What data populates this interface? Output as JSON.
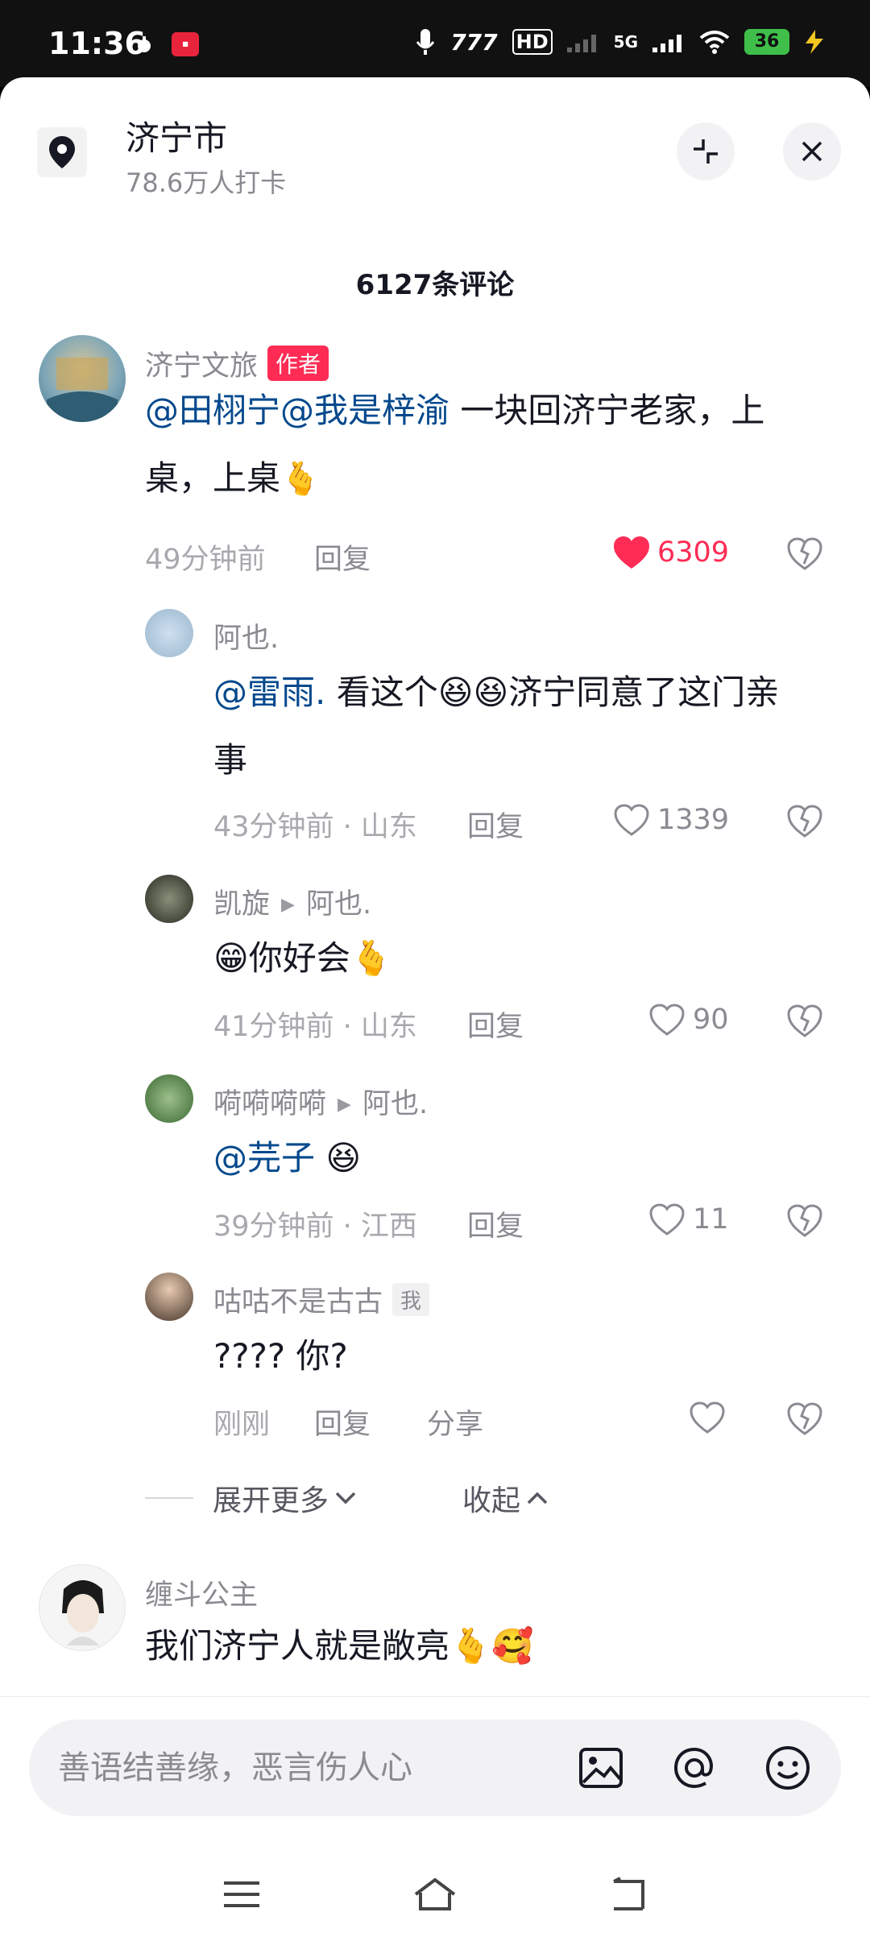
{
  "status": {
    "time": "11:36",
    "network": "5G",
    "battery": "36"
  },
  "header": {
    "location_name": "济宁市",
    "checkins": "78.6万人打卡"
  },
  "comments_title": "6127条评论",
  "comments": [
    {
      "user": "济宁文旅",
      "tag": "作者",
      "mention": "@田栩宁@我是梓渝",
      "text_line1": " 一块回济宁老家，上",
      "text_line2": "桌，上桌",
      "time": "49分钟前",
      "reply": "回复",
      "likes": "6309"
    },
    {
      "user": "阿也.",
      "mention": "@雷雨.",
      "text_line1": " 看这个😆😆济宁同意了这门亲",
      "text_line2": "事",
      "time": "43分钟前 · 山东",
      "reply": "回复",
      "likes": "1339"
    },
    {
      "user": "凯旋",
      "reply_to": "阿也.",
      "text": "😁你好会🫰",
      "time": "41分钟前 · 山东",
      "reply": "回复",
      "likes": "90"
    },
    {
      "user": "嗬嗬嗬嗬",
      "reply_to": "阿也.",
      "mention": "@芫子",
      "text": " 😆",
      "time": "39分钟前 · 江西",
      "reply": "回复",
      "likes": "11"
    },
    {
      "user": "咕咕不是古古",
      "tag": "我",
      "text": "????  你?",
      "time": "刚刚",
      "reply": "回复",
      "share": "分享"
    },
    {
      "user": "缠斗公主",
      "text": "我们济宁人就是敞亮🫰🥰"
    }
  ],
  "expand": {
    "more": "展开更多",
    "collapse": "收起"
  },
  "input": {
    "placeholder": "善语结善缘，恶言伤人心"
  },
  "icons": {
    "heart_active_color": "#fe2c55",
    "mention_color": "#04498d"
  }
}
